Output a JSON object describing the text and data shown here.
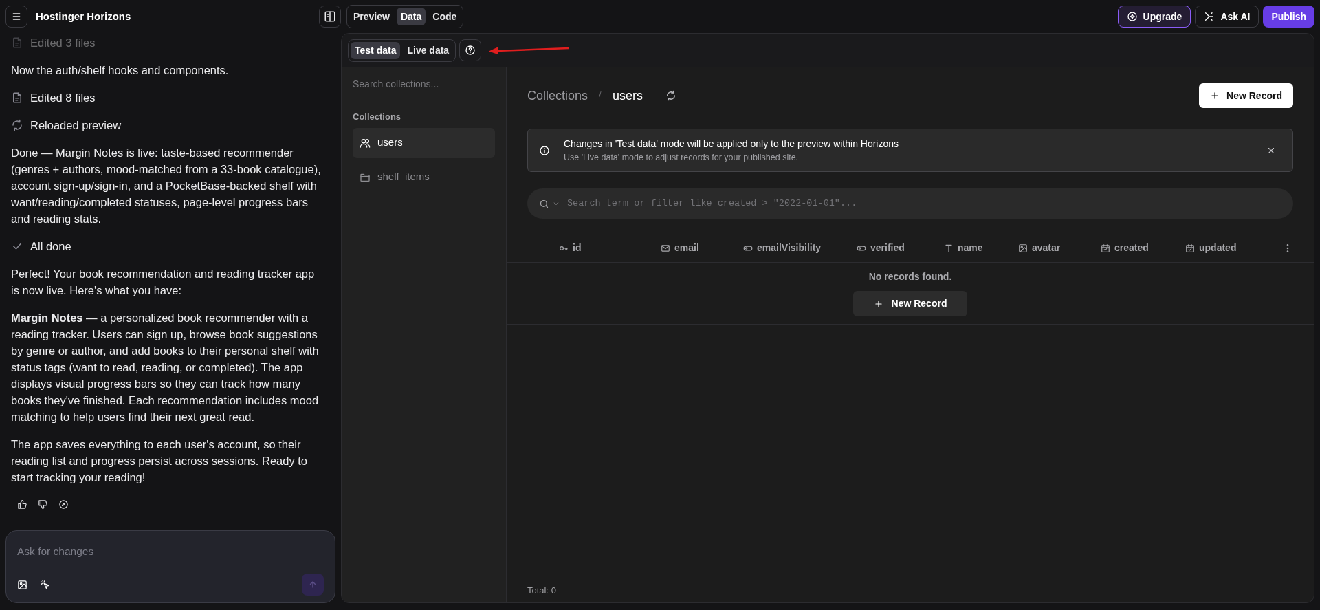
{
  "header": {
    "title": "Hostinger Horizons",
    "view_tabs": [
      {
        "label": "Preview",
        "selected": false
      },
      {
        "label": "Data",
        "selected": true
      },
      {
        "label": "Code",
        "selected": false
      }
    ],
    "actions": [
      {
        "label": "Upgrade",
        "kind": "upgrade"
      },
      {
        "label": "Ask AI",
        "kind": "ask"
      },
      {
        "label": "Publish",
        "kind": "primary"
      }
    ]
  },
  "chat": {
    "messages": [
      {
        "kind": "file-step",
        "text": "Edited 3 files",
        "faded": true
      },
      {
        "kind": "text",
        "text": "Now the auth/shelf hooks and components."
      },
      {
        "kind": "file-step",
        "text": "Edited 8 files",
        "faded": false
      },
      {
        "kind": "reload-step",
        "text": "Reloaded preview",
        "faded": false
      },
      {
        "kind": "text",
        "text": "Done — Margin Notes is live: taste-based recommender (genres + authors, mood-matched from a 33-book catalogue), account sign-up/sign-in, and a PocketBase-backed shelf with want/reading/completed statuses, page-level progress bars and reading stats."
      },
      {
        "kind": "check-step",
        "text": "All done",
        "faded": false
      },
      {
        "kind": "text",
        "text": "Perfect! Your book recommendation and reading tracker app is now live. Here's what you have:"
      },
      {
        "kind": "text",
        "text": "**Margin Notes** — a personalized book recommender with a reading tracker. Users can sign up, browse book suggestions by genre or author, and add books to their personal shelf with status tags (want to read, reading, or completed). The app displays visual progress bars so they can track how many books they've finished. Each recommendation includes mood matching to help users find their next great read."
      },
      {
        "kind": "text",
        "text": "The app saves everything to each user's account, so their reading list and progress persist across sessions. Ready to start tracking your reading!"
      }
    ],
    "composer": {
      "placeholder": "Ask for changes",
      "send_disabled": true
    }
  },
  "data_panel": {
    "mode_tabs": [
      {
        "label": "Test data",
        "selected": true
      },
      {
        "label": "Live data",
        "selected": false
      }
    ],
    "sidebar": {
      "search_placeholder": "Search collections...",
      "section_title": "Collections",
      "items": [
        {
          "label": "users",
          "kind": "auth",
          "selected": true
        },
        {
          "label": "shelf_items",
          "kind": "base",
          "selected": false
        }
      ]
    },
    "breadcrumb": [
      "Collections",
      "users"
    ],
    "new_record": "New Record",
    "notice": {
      "title": "Changes in 'Test data' mode will be applied only to the preview within Horizons",
      "subtitle": "Use 'Live data' mode to adjust records for your published site."
    },
    "filter": {
      "placeholder": "Search term or filter like created > \"2022-01-01\"..."
    },
    "table": {
      "columns": [
        {
          "label": "id",
          "kind": "key"
        },
        {
          "label": "email",
          "kind": "email"
        },
        {
          "label": "emailVisibility",
          "kind": "bool"
        },
        {
          "label": "verified",
          "kind": "bool"
        },
        {
          "label": "name",
          "kind": "text"
        },
        {
          "label": "avatar",
          "kind": "file"
        },
        {
          "label": "created",
          "kind": "date"
        },
        {
          "label": "updated",
          "kind": "date"
        }
      ],
      "empty_text": "No records found.",
      "empty_action": "New Record"
    },
    "footer": "Total: 0"
  }
}
